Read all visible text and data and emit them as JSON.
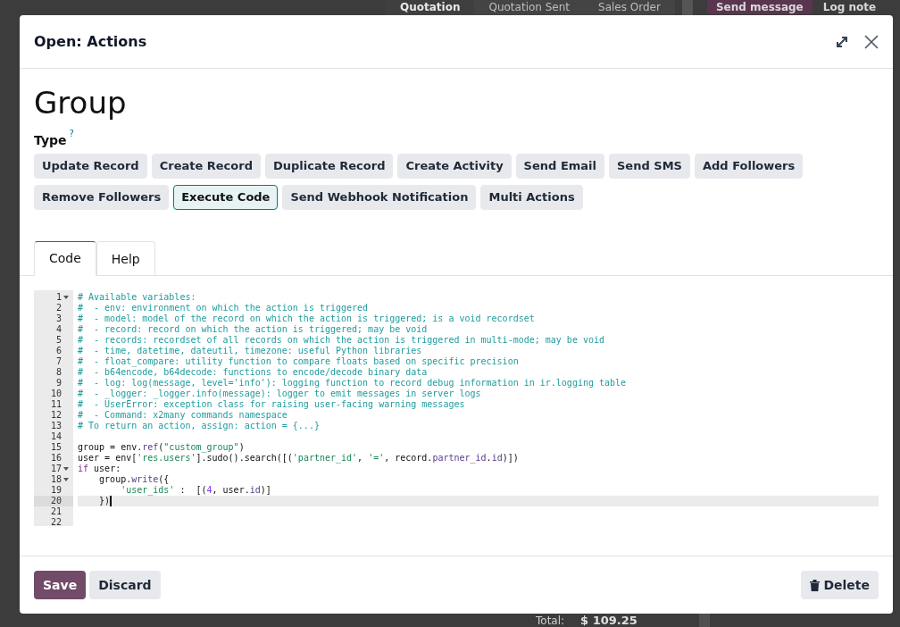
{
  "background": {
    "stages": [
      {
        "label": "Quotation",
        "selected": true
      },
      {
        "label": "Quotation Sent",
        "selected": false
      },
      {
        "label": "Sales Order",
        "selected": false
      }
    ],
    "send_message": "Send message",
    "log_note": "Log note",
    "total_label": "Total:",
    "total_value": "$ 109.25"
  },
  "dialog": {
    "title": "Open: Actions",
    "name": "Group",
    "type_label": "Type",
    "type_help": "?",
    "types": [
      {
        "label": "Update Record",
        "selected": false
      },
      {
        "label": "Create Record",
        "selected": false
      },
      {
        "label": "Duplicate Record",
        "selected": false
      },
      {
        "label": "Create Activity",
        "selected": false
      },
      {
        "label": "Send Email",
        "selected": false
      },
      {
        "label": "Send SMS",
        "selected": false
      },
      {
        "label": "Add Followers",
        "selected": false
      },
      {
        "label": "Remove Followers",
        "selected": false
      },
      {
        "label": "Execute Code",
        "selected": true
      },
      {
        "label": "Send Webhook Notification",
        "selected": false
      },
      {
        "label": "Multi Actions",
        "selected": false
      }
    ],
    "tabs": [
      {
        "label": "Code",
        "selected": true
      },
      {
        "label": "Help",
        "selected": false
      }
    ],
    "code_lines": [
      {
        "number": "1",
        "foldable": true,
        "active": false,
        "tokens": [
          {
            "kind": "comment",
            "text": "# Available variables:"
          }
        ]
      },
      {
        "number": "2",
        "foldable": false,
        "active": false,
        "tokens": [
          {
            "kind": "comment",
            "text": "#  - env: environment on which the action is triggered"
          }
        ]
      },
      {
        "number": "3",
        "foldable": false,
        "active": false,
        "tokens": [
          {
            "kind": "comment",
            "text": "#  - model: model of the record on which the action is triggered; is a void recordset"
          }
        ]
      },
      {
        "number": "4",
        "foldable": false,
        "active": false,
        "tokens": [
          {
            "kind": "comment",
            "text": "#  - record: record on which the action is triggered; may be void"
          }
        ]
      },
      {
        "number": "5",
        "foldable": false,
        "active": false,
        "tokens": [
          {
            "kind": "comment",
            "text": "#  - records: recordset of all records on which the action is triggered in multi-mode; may be void"
          }
        ]
      },
      {
        "number": "6",
        "foldable": false,
        "active": false,
        "tokens": [
          {
            "kind": "comment",
            "text": "#  - time, datetime, dateutil, timezone: useful Python libraries"
          }
        ]
      },
      {
        "number": "7",
        "foldable": false,
        "active": false,
        "tokens": [
          {
            "kind": "comment",
            "text": "#  - float_compare: utility function to compare floats based on specific precision"
          }
        ]
      },
      {
        "number": "8",
        "foldable": false,
        "active": false,
        "tokens": [
          {
            "kind": "comment",
            "text": "#  - b64encode, b64decode: functions to encode/decode binary data"
          }
        ]
      },
      {
        "number": "9",
        "foldable": false,
        "active": false,
        "tokens": [
          {
            "kind": "comment",
            "text": "#  - log: log(message, level='info'): logging function to record debug information in ir.logging table"
          }
        ]
      },
      {
        "number": "10",
        "foldable": false,
        "active": false,
        "tokens": [
          {
            "kind": "comment",
            "text": "#  - _logger: _logger.info(message): logger to emit messages in server logs"
          }
        ]
      },
      {
        "number": "11",
        "foldable": false,
        "active": false,
        "tokens": [
          {
            "kind": "comment",
            "text": "#  - UserError: exception class for raising user-facing warning messages"
          }
        ]
      },
      {
        "number": "12",
        "foldable": false,
        "active": false,
        "tokens": [
          {
            "kind": "comment",
            "text": "#  - Command: x2many commands namespace"
          }
        ]
      },
      {
        "number": "13",
        "foldable": false,
        "active": false,
        "tokens": [
          {
            "kind": "comment",
            "text": "# To return an action, assign: action = {...}"
          }
        ]
      },
      {
        "number": "14",
        "foldable": false,
        "active": false
      },
      {
        "number": "15",
        "foldable": false,
        "active": false,
        "tokens": [
          {
            "kind": "plain",
            "text": "group = env."
          },
          {
            "kind": "attr",
            "text": "ref"
          },
          {
            "kind": "plain",
            "text": "("
          },
          {
            "kind": "string",
            "text": "\"custom_group\""
          },
          {
            "kind": "plain",
            "text": ")"
          }
        ]
      },
      {
        "number": "16",
        "foldable": false,
        "active": false,
        "tokens": [
          {
            "kind": "plain",
            "text": "user = env["
          },
          {
            "kind": "string",
            "text": "'res.users'"
          },
          {
            "kind": "plain",
            "text": "].sudo().search([("
          },
          {
            "kind": "string",
            "text": "'partner_id'"
          },
          {
            "kind": "plain",
            "text": ", "
          },
          {
            "kind": "string",
            "text": "'='"
          },
          {
            "kind": "plain",
            "text": ", record."
          },
          {
            "kind": "attr",
            "text": "partner_id"
          },
          {
            "kind": "plain",
            "text": "."
          },
          {
            "kind": "attr",
            "text": "id"
          },
          {
            "kind": "plain",
            "text": ")])"
          }
        ]
      },
      {
        "number": "17",
        "foldable": true,
        "active": false,
        "tokens": [
          {
            "kind": "keyword",
            "text": "if"
          },
          {
            "kind": "plain",
            "text": " user:"
          }
        ]
      },
      {
        "number": "18",
        "foldable": true,
        "active": false,
        "tokens": [
          {
            "kind": "plain",
            "text": "    group."
          },
          {
            "kind": "attr",
            "text": "write"
          },
          {
            "kind": "plain",
            "text": "({"
          }
        ]
      },
      {
        "number": "19",
        "foldable": false,
        "active": false,
        "tokens": [
          {
            "kind": "string",
            "text": "        'user_ids'"
          },
          {
            "kind": "plain",
            "text": " :  [("
          },
          {
            "kind": "number",
            "text": "4"
          },
          {
            "kind": "plain",
            "text": ", user."
          },
          {
            "kind": "attr",
            "text": "id"
          },
          {
            "kind": "plain",
            "text": ")]"
          }
        ]
      },
      {
        "number": "20",
        "foldable": false,
        "active": true,
        "tokens": [
          {
            "kind": "plain",
            "text": "    })"
          }
        ]
      },
      {
        "number": "21",
        "foldable": false,
        "active": false
      },
      {
        "number": "22",
        "foldable": false,
        "active": false
      }
    ],
    "save": "Save",
    "discard": "Discard",
    "delete": "Delete"
  }
}
